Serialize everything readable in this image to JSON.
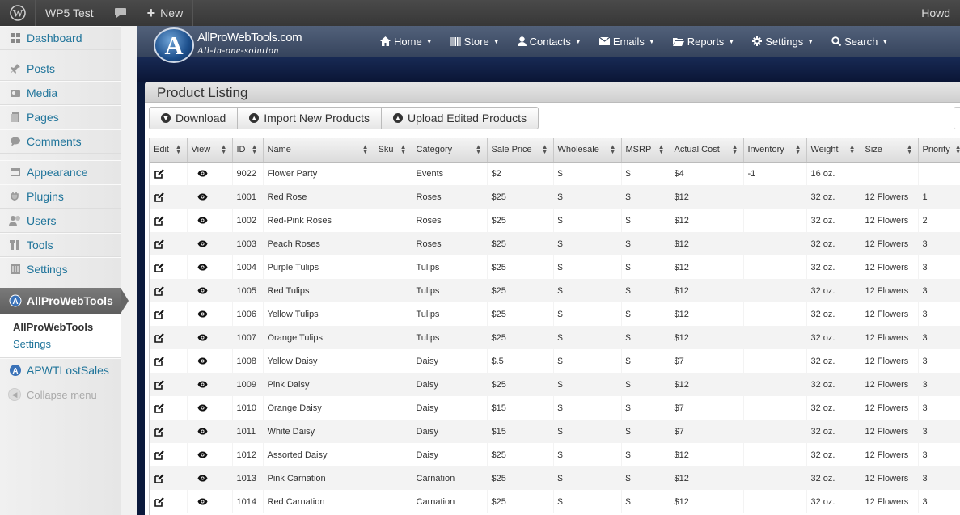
{
  "adminbar": {
    "site_name": "WP5 Test",
    "new_label": "New",
    "howdy": "Howd"
  },
  "sidebar": {
    "items": [
      {
        "label": "Dashboard",
        "icon": "dashboard-icon"
      },
      {
        "label": "Posts",
        "icon": "pin-icon"
      },
      {
        "label": "Media",
        "icon": "media-icon"
      },
      {
        "label": "Pages",
        "icon": "pages-icon"
      },
      {
        "label": "Comments",
        "icon": "comment-icon"
      },
      {
        "label": "Appearance",
        "icon": "appearance-icon"
      },
      {
        "label": "Plugins",
        "icon": "plugin-icon"
      },
      {
        "label": "Users",
        "icon": "users-icon"
      },
      {
        "label": "Tools",
        "icon": "tools-icon"
      },
      {
        "label": "Settings",
        "icon": "settings-icon"
      }
    ],
    "active": "AllProWebTools",
    "submenu": [
      "AllProWebTools",
      "Settings"
    ],
    "lost_sales": "APWTLostSales",
    "collapse": "Collapse menu"
  },
  "header": {
    "brand_line1": "AllProWebTools.com",
    "brand_line2": "All-in-one-solution",
    "nav": [
      "Home",
      "Store",
      "Contacts",
      "Emails",
      "Reports",
      "Settings",
      "Search"
    ]
  },
  "panel": {
    "title": "Product Listing",
    "buttons": [
      "Download",
      "Import New Products",
      "Upload Edited Products"
    ]
  },
  "table": {
    "columns": [
      "Edit",
      "View",
      "ID",
      "Name",
      "Sku",
      "Category",
      "Sale Price",
      "Wholesale",
      "MSRP",
      "Actual Cost",
      "Inventory",
      "Weight",
      "Size",
      "Priority"
    ],
    "rows": [
      [
        "9022",
        "Flower Party",
        "",
        "Events",
        "$2",
        "$",
        "$",
        "$4",
        "-1",
        "16 oz.",
        "",
        ""
      ],
      [
        "1001",
        "Red Rose",
        "",
        "Roses",
        "$25",
        "$",
        "$",
        "$12",
        "",
        "32 oz.",
        "12 Flowers",
        "1"
      ],
      [
        "1002",
        "Red-Pink Roses",
        "",
        "Roses",
        "$25",
        "$",
        "$",
        "$12",
        "",
        "32 oz.",
        "12 Flowers",
        "2"
      ],
      [
        "1003",
        "Peach Roses",
        "",
        "Roses",
        "$25",
        "$",
        "$",
        "$12",
        "",
        "32 oz.",
        "12 Flowers",
        "3"
      ],
      [
        "1004",
        "Purple Tulips",
        "",
        "Tulips",
        "$25",
        "$",
        "$",
        "$12",
        "",
        "32 oz.",
        "12 Flowers",
        "3"
      ],
      [
        "1005",
        "Red Tulips",
        "",
        "Tulips",
        "$25",
        "$",
        "$",
        "$12",
        "",
        "32 oz.",
        "12 Flowers",
        "3"
      ],
      [
        "1006",
        "Yellow Tulips",
        "",
        "Tulips",
        "$25",
        "$",
        "$",
        "$12",
        "",
        "32 oz.",
        "12 Flowers",
        "3"
      ],
      [
        "1007",
        "Orange Tulips",
        "",
        "Tulips",
        "$25",
        "$",
        "$",
        "$12",
        "",
        "32 oz.",
        "12 Flowers",
        "3"
      ],
      [
        "1008",
        "Yellow Daisy",
        "",
        "Daisy",
        "$.5",
        "$",
        "$",
        "$7",
        "",
        "32 oz.",
        "12 Flowers",
        "3"
      ],
      [
        "1009",
        "Pink Daisy",
        "",
        "Daisy",
        "$25",
        "$",
        "$",
        "$12",
        "",
        "32 oz.",
        "12 Flowers",
        "3"
      ],
      [
        "1010",
        "Orange Daisy",
        "",
        "Daisy",
        "$15",
        "$",
        "$",
        "$7",
        "",
        "32 oz.",
        "12 Flowers",
        "3"
      ],
      [
        "1011",
        "White Daisy",
        "",
        "Daisy",
        "$15",
        "$",
        "$",
        "$7",
        "",
        "32 oz.",
        "12 Flowers",
        "3"
      ],
      [
        "1012",
        "Assorted Daisy",
        "",
        "Daisy",
        "$25",
        "$",
        "$",
        "$12",
        "",
        "32 oz.",
        "12 Flowers",
        "3"
      ],
      [
        "1013",
        "Pink Carnation",
        "",
        "Carnation",
        "$25",
        "$",
        "$",
        "$12",
        "",
        "32 oz.",
        "12 Flowers",
        "3"
      ],
      [
        "1014",
        "Red Carnation",
        "",
        "Carnation",
        "$25",
        "$",
        "$",
        "$12",
        "",
        "32 oz.",
        "12 Flowers",
        "3"
      ]
    ]
  }
}
